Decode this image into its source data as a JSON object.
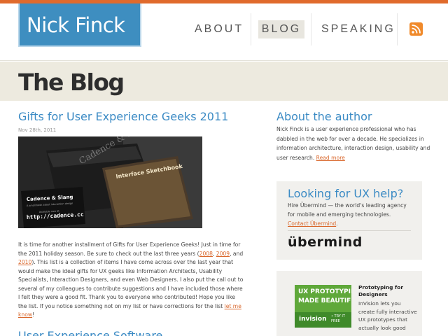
{
  "header": {
    "logo_text": "Nick Finck",
    "nav": {
      "about": "ABOUT",
      "blog": "BLOG",
      "speaking": "SPEAKING"
    },
    "rss_icon": "rss-icon"
  },
  "page": {
    "title": "The Blog"
  },
  "post": {
    "title": "Gifts for User Experience Geeks 2011",
    "date": "Nov 28th, 2011",
    "image_text": {
      "book_title": "Interface Sketchbook",
      "card_line1": "Cadence & Slang",
      "card_line2": "A small book about interaction design",
      "card_line3": "Available now at",
      "card_url": "http://cadence.cc",
      "spine_text": "Cadence & Slang"
    },
    "body": {
      "p1": "It is time for another installment of Gifts for User Experience Geeks! Just in time for the 2011 holiday season. Be sure to check out the last three years (",
      "link_2008": "2008",
      "sep1": ", ",
      "link_2009": "2009",
      "sep2": ", and ",
      "link_2010": "2010",
      "p2": "). This list is a collection of items I have come across over the last year that would make the ideal gifts for UX geeks like Information Architects, Usability Specialists, Interaction Designers, and even Web Designers. I also put the call out to several of my colleagues to contribute suggestions and I have included those where I felt they were a good fit. Thank you to everyone who contributed! Hope you like the list. If you notice something not on my list or have corrections for the list ",
      "link_letme": "let me know",
      "end": "!"
    },
    "next_heading": "User Experience Software"
  },
  "sidebar": {
    "about": {
      "title": "About the author",
      "text": "Nick Finck is a user experience professional who has dabbled in the web for over a decade. He specializes in information architecture, interaction design, usability and user research. ",
      "read_more": "Read more"
    },
    "ux_help": {
      "title": "Looking for UX help?",
      "text": "Hire Übermind — the world's leading agency for mobile and emerging technologies.",
      "link": "Contact Übermind",
      "end": ".",
      "logo_text": "übermind"
    },
    "ad": {
      "image_line1": "UX PROTOTYPING",
      "image_line2": "MADE BEAUTIFUL",
      "brand": "invision",
      "try_text": "• TRY IT FREE",
      "heading": "Prototyping for Designers",
      "text": "InVision lets you create fully interactive UX prototypes that actually look good"
    }
  }
}
